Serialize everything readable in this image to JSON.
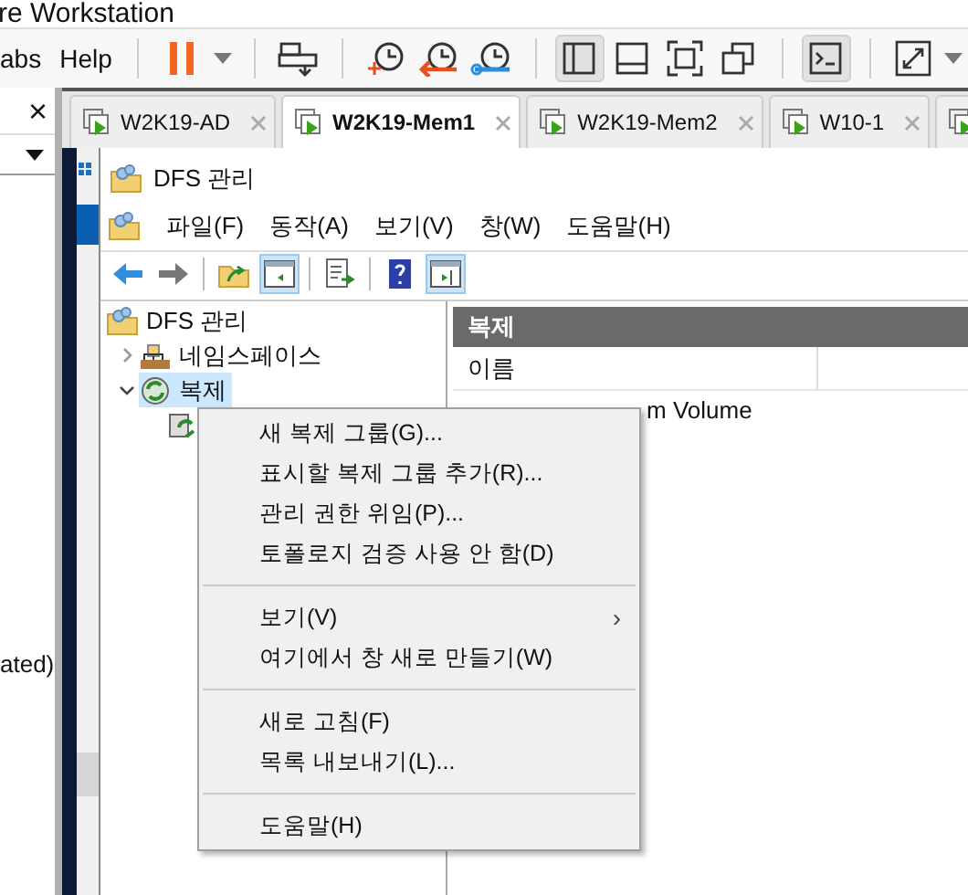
{
  "window": {
    "title": "re Workstation"
  },
  "menu": [
    {
      "label": "abs"
    },
    {
      "label": "Help"
    }
  ],
  "toolbar": [
    {
      "kind": "pause",
      "pressed": false
    },
    {
      "kind": "caret",
      "pressed": false
    },
    {
      "kind": "sep"
    },
    {
      "kind": "send-keys",
      "pressed": false
    },
    {
      "kind": "sep"
    },
    {
      "kind": "snapshot-add",
      "pressed": false
    },
    {
      "kind": "snapshot-revert",
      "pressed": false
    },
    {
      "kind": "snapshot-manage",
      "pressed": false
    },
    {
      "kind": "sep"
    },
    {
      "kind": "sidebar",
      "pressed": true
    },
    {
      "kind": "bottom-panel",
      "pressed": false
    },
    {
      "kind": "fullscreen",
      "pressed": false
    },
    {
      "kind": "unity",
      "pressed": false
    },
    {
      "kind": "sep"
    },
    {
      "kind": "console",
      "pressed": true
    },
    {
      "kind": "sep"
    },
    {
      "kind": "stretch",
      "pressed": false
    },
    {
      "kind": "caret",
      "pressed": false
    }
  ],
  "library": {
    "close": "×",
    "text": "ated)"
  },
  "vm_tabs": [
    {
      "label": "W2K19-AD",
      "selected": false
    },
    {
      "label": "W2K19-Mem1",
      "selected": true
    },
    {
      "label": "W2K19-Mem2",
      "selected": false
    },
    {
      "label": "W10-1",
      "selected": false
    },
    {
      "selected": false
    }
  ],
  "mmc": {
    "title": "DFS 관리",
    "menu": [
      "파일(F)",
      "동작(A)",
      "보기(V)",
      "창(W)",
      "도움말(H)"
    ],
    "toolbar": [
      {
        "kind": "back",
        "pressed": false
      },
      {
        "kind": "forward",
        "pressed": false
      },
      {
        "kind": "sep"
      },
      {
        "kind": "up",
        "pressed": false
      },
      {
        "kind": "tree",
        "pressed": true
      },
      {
        "kind": "sep"
      },
      {
        "kind": "export",
        "pressed": false
      },
      {
        "kind": "sep"
      },
      {
        "kind": "help",
        "pressed": false
      },
      {
        "kind": "action-pane",
        "pressed": true
      }
    ],
    "tree": [
      {
        "label": "DFS 관리",
        "kind": "dfs",
        "selected": false,
        "children": [
          {
            "label": "네임스페이스",
            "kind": "namespace",
            "expanded": false,
            "selected": false
          },
          {
            "label": "복제",
            "kind": "replication",
            "expanded": true,
            "selected": true,
            "children": [
              {
                "kind": "replication-group",
                "selected": false
              }
            ]
          }
        ]
      }
    ],
    "pane": {
      "header": "복제",
      "columns": [
        "이름"
      ],
      "rows": [
        "m Volume"
      ]
    },
    "context_menu": [
      {
        "label": "새 복제 그룹(G)...",
        "kind": "item"
      },
      {
        "label": "표시할 복제 그룹 추가(R)...",
        "kind": "item"
      },
      {
        "label": "관리 권한 위임(P)...",
        "kind": "item"
      },
      {
        "label": "토폴로지 검증 사용 안 함(D)",
        "kind": "item"
      },
      {
        "kind": "separator"
      },
      {
        "label": "보기(V)",
        "kind": "submenu",
        "arrow": "›"
      },
      {
        "label": "여기에서 창 새로 만들기(W)",
        "kind": "item"
      },
      {
        "kind": "separator"
      },
      {
        "label": "새로 고침(F)",
        "kind": "item"
      },
      {
        "label": "목록 내보내기(L)...",
        "kind": "item"
      },
      {
        "kind": "separator"
      },
      {
        "label": "도움말(H)",
        "kind": "item"
      }
    ]
  }
}
